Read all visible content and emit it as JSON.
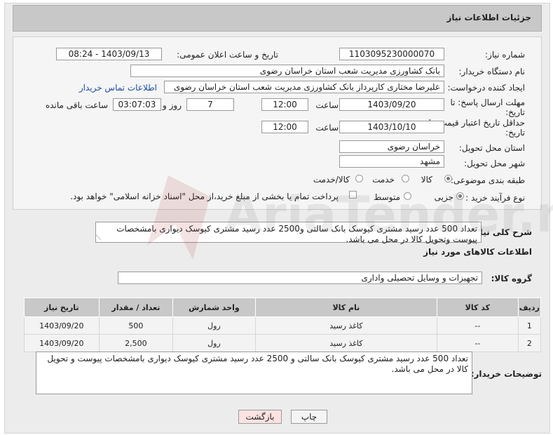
{
  "header": {
    "title": "جزئیات اطلاعات نیاز"
  },
  "form": {
    "need_number_label": "شماره نیاز:",
    "need_number": "1103095230000070",
    "announce_label": "تاریخ و ساعت اعلان عمومی:",
    "announce_value": "1403/09/13 - 08:24",
    "buyer_org_label": "نام دستگاه خریدار:",
    "buyer_org": "بانک کشاورزی مدیریت شعب استان خراسان رضوی",
    "creator_label": "ایجاد کننده درخواست:",
    "creator": "علیرضا مختاری کارپرداز بانک کشاورزی مدیریت شعب استان خراسان رضوی",
    "contact_link": "اطلاعات تماس خریدار",
    "send_deadline_label_1": "مهلت ارسال پاسخ: تا",
    "send_deadline_label_2": "تاریخ:",
    "send_deadline_date": "1403/09/20",
    "time_label": "ساعت",
    "send_deadline_time": "12:00",
    "days_value": "7",
    "days_label": "روز و",
    "remaining_time": "03:07:03",
    "remaining_label": "ساعت باقی مانده",
    "price_validity_label_1": "حداقل تاریخ اعتبار قیمت: تا",
    "price_validity_label_2": "تاریخ:",
    "price_validity_date": "1403/10/10",
    "price_validity_time": "12:00",
    "province_label": "استان محل تحویل:",
    "province": "خراسان رضوی",
    "city_label": "شهر محل تحویل:",
    "city": "مشهد",
    "category_label": "طبقه بندی موضوعی:",
    "category_options": [
      "کالا",
      "خدمت",
      "کالا/خدمت"
    ],
    "category_selected": "کالا",
    "process_label": "نوع فرآیند خرید :",
    "process_options": [
      "جزیی",
      "متوسط"
    ],
    "process_selected": "جزیی",
    "payment_note": "پرداخت تمام یا بخشی از مبلغ خرید،از محل \"اسناد خزانه اسلامی\" خواهد بود."
  },
  "summary": {
    "label": "شرح کلی نیاز:",
    "text": "تعداد 500 عدد رسید مشتری کیوسک بانک سالتی و2500 عدد رسید مشتری کیوسک دیواری بامشخصات پیوست وتحویل کالا در محل می باشد."
  },
  "goods": {
    "section_title": "اطلاعات کالاهای مورد نیاز",
    "group_label": "گروه کالا:",
    "group_value": "تجهیزات و وسایل تحصیلی واداری",
    "columns": [
      "ردیف",
      "کد کالا",
      "نام کالا",
      "واحد شمارش",
      "تعداد / مقدار",
      "تاریخ نیاز"
    ],
    "rows": [
      [
        "1",
        "--",
        "کاغذ رسید",
        "رول",
        "500",
        "1403/09/20"
      ],
      [
        "2",
        "--",
        "کاغذ رسید",
        "رول",
        "2,500",
        "1403/09/20"
      ]
    ]
  },
  "buyer_notes": {
    "label": "توضیحات خریدار:",
    "text": "تعداد 500 عدد رسید مشتری کیوسک بانک سالتی و  2500 عدد رسید مشتری کیوسک دیواری بامشخصات پیوست و تحویل کالا در محل می باشد."
  },
  "buttons": {
    "print": "چاپ",
    "back": "بازگشت"
  },
  "watermark": {
    "text": "AriaTender.neT"
  },
  "colors": {
    "header_bg": "#c8c8c8",
    "back_button_bg": "#fde2e2",
    "link": "#1a4fa0"
  }
}
